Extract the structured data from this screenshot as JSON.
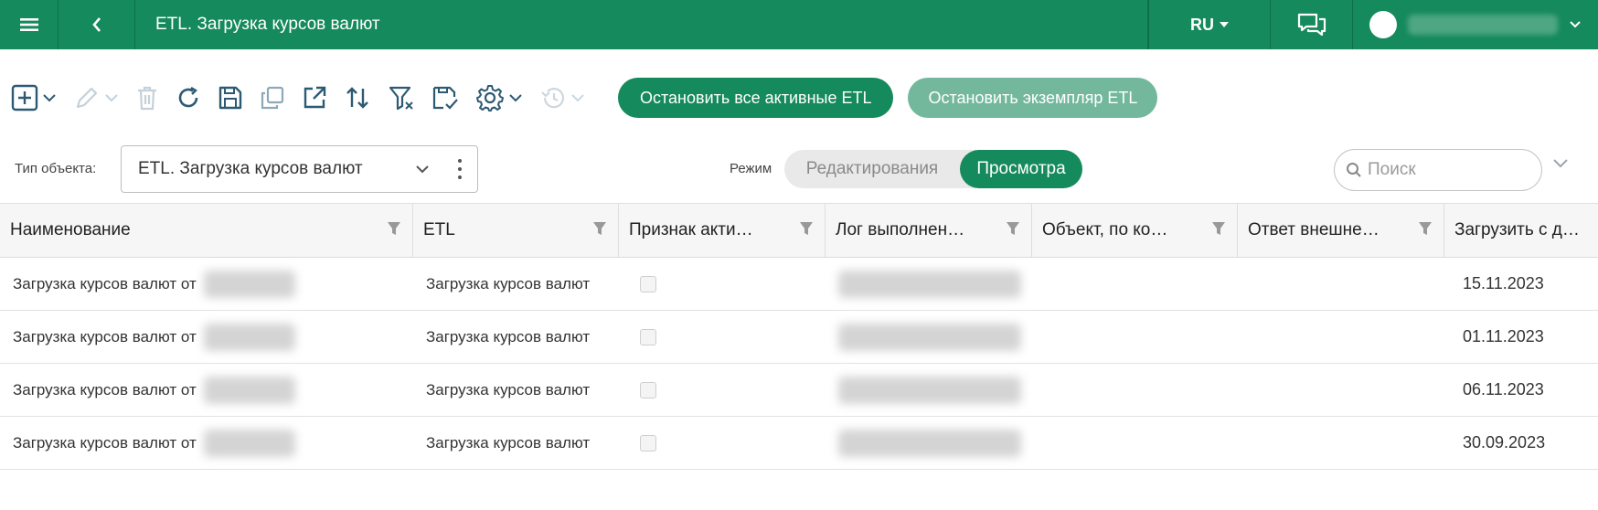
{
  "header": {
    "title": "ETL. Загрузка курсов валют",
    "language": "RU"
  },
  "toolbar": {
    "stop_all_label": "Остановить все активные ETL",
    "stop_instance_label": "Остановить экземпляр ETL"
  },
  "filters": {
    "object_type_label": "Тип объекта:",
    "object_type_value": "ETL. Загрузка курсов валют",
    "mode_label": "Режим",
    "mode_edit": "Редактирования",
    "mode_view": "Просмотра",
    "search_placeholder": "Поиск"
  },
  "table": {
    "columns": [
      "Наименование",
      "ETL",
      "Признак акти…",
      "Лог выполнен…",
      "Объект, по ко…",
      "Ответ внешне…",
      "Загрузить с д…"
    ],
    "rows": [
      {
        "name": "Загрузка курсов валют от",
        "etl": "Загрузка курсов валют",
        "date": "15.11.2023"
      },
      {
        "name": "Загрузка курсов валют от",
        "etl": "Загрузка курсов валют",
        "date": "01.11.2023"
      },
      {
        "name": "Загрузка курсов валют от",
        "etl": "Загрузка курсов валют",
        "date": "06.11.2023"
      },
      {
        "name": "Загрузка курсов валют от",
        "etl": "Загрузка курсов валют",
        "date": "30.09.2023"
      }
    ]
  },
  "colors": {
    "brand": "#158a5c",
    "brand_light": "#73b89d"
  }
}
